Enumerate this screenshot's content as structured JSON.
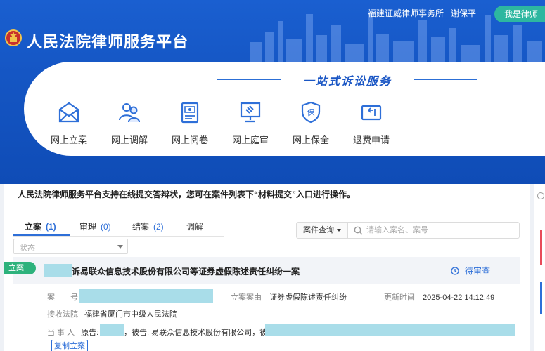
{
  "header": {
    "firm": "福建证威律师事务所",
    "user": "谢保平",
    "lawyer_button": "我是律师",
    "title": "人民法院律师服务平台",
    "slogan": "一站式诉讼服务"
  },
  "services": [
    {
      "label": "网上立案",
      "icon": "envelope-icon"
    },
    {
      "label": "网上调解",
      "icon": "people-icon"
    },
    {
      "label": "网上阅卷",
      "icon": "document-icon"
    },
    {
      "label": "网上庭审",
      "icon": "gavel-icon"
    },
    {
      "label": "网上保全",
      "icon": "shield-icon",
      "icon_text": "保"
    },
    {
      "label": "退费申请",
      "icon": "refund-icon"
    }
  ],
  "notice": "人民法院律师服务平台支持在线提交答辩状，您可在案件列表下“材料提交”入口进行操作。",
  "tabs": [
    {
      "label": "立案",
      "count": "(1)"
    },
    {
      "label": "审理",
      "count": "(0)"
    },
    {
      "label": "结案",
      "count": "(2)"
    },
    {
      "label": "调解",
      "count": ""
    }
  ],
  "filters": {
    "status_placeholder": "状态",
    "search_type": "案件查询",
    "search_placeholder": "请输入案名、案号"
  },
  "case": {
    "tag": "立案",
    "title": "诉易联众信息技术股份有限公司等证券虚假陈述责任纠纷一案",
    "status": "待审查",
    "case_no_label": "案　　号",
    "cause_label": "立案案由",
    "cause_value": "证券虚假陈述责任纠纷",
    "updated_label": "更新时间",
    "updated_value": "2025-04-22 14:12:49",
    "court_label": "接收法院",
    "court_value": "福建省厦门市中级人民法院",
    "parties_label": "当 事 人",
    "plaintiff_label": "原告:",
    "defendant_label": "，被告:",
    "defendant_value": "易联众信息技术股份有限公司，被告:",
    "copy_button": "复制立案"
  },
  "colors": {
    "header_blue": "#1556c4",
    "accent_blue": "#2e6fd8",
    "green": "#2db27c",
    "teal": "#2db7a0",
    "redaction": "#a9dde9"
  }
}
